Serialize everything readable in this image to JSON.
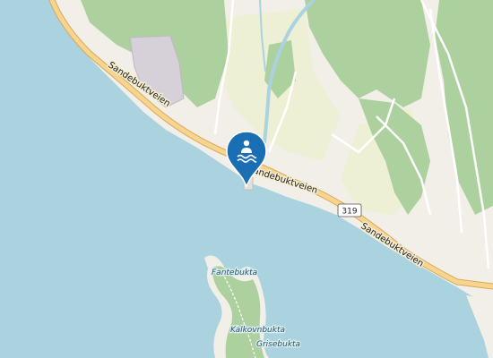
{
  "map": {
    "road_labels": [
      "Sandebuktveien",
      "Sandebuktveien",
      "Sandebuktveien"
    ],
    "route_shield": "319",
    "place_labels": [
      "Fantebukta",
      "Kalkovnbukta",
      "Grisebukta"
    ],
    "marker_icon": "swimming-icon",
    "colors": {
      "water": "#aad3df",
      "land": "#f2efe9",
      "forest": "#add19e",
      "farmland": "#eef0d5",
      "road_casing": "#d9a85a",
      "road": "#f7d58e",
      "marker": "#1a6fb4"
    }
  }
}
